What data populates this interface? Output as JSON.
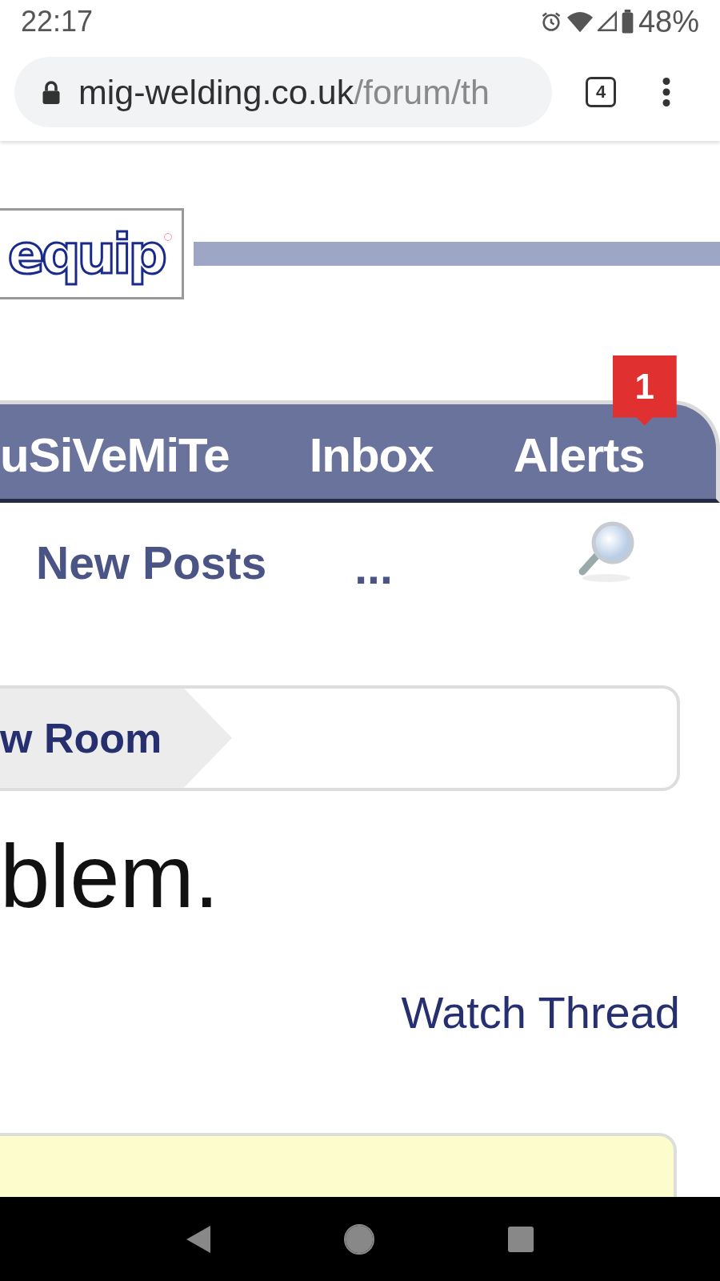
{
  "status_bar": {
    "time": "22:17",
    "battery": "48%"
  },
  "browser": {
    "url_host": "mig-welding.co.uk",
    "url_path": "/forum/th",
    "tab_count": "4"
  },
  "logo": {
    "text": "equip"
  },
  "nav_tabs": [
    {
      "label": "uSiVeMiTe"
    },
    {
      "label": "Inbox"
    },
    {
      "label": "Alerts",
      "badge": "1"
    }
  ],
  "sub_nav": [
    {
      "label": "New Posts",
      "kind": "link"
    },
    {
      "label": "...",
      "kind": "more"
    }
  ],
  "breadcrumb": [
    {
      "label": "w Room"
    }
  ],
  "thread_title": "blem.",
  "watch_link": "Watch Thread"
}
